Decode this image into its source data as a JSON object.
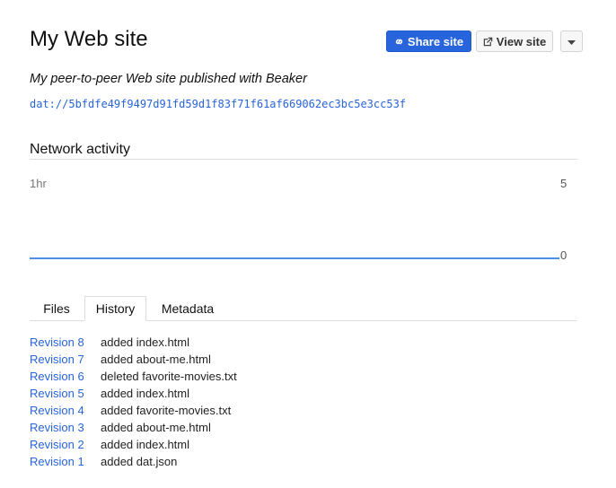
{
  "site": {
    "title": "My Web site",
    "description": "My peer-to-peer Web site published with Beaker",
    "url": "dat://5bfdfe49f9497d91fd59d1f83f71f61af669062ec3bc5e3cc53f"
  },
  "actions": {
    "share_label": "Share site",
    "share_icon": "link-icon",
    "view_label": "View site",
    "view_icon": "external-link-icon",
    "more_icon": "caret-down-icon"
  },
  "network": {
    "heading": "Network activity",
    "time_window": "1hr",
    "max_label": "5",
    "min_label": "0",
    "series_color": "#4a90e2"
  },
  "chart_data": {
    "type": "line",
    "x": [
      0,
      1
    ],
    "values": [
      0,
      0
    ],
    "ylim": [
      0,
      5
    ],
    "grid": false
  },
  "tabs": [
    {
      "label": "Files",
      "active": false
    },
    {
      "label": "History",
      "active": true
    },
    {
      "label": "Metadata",
      "active": false
    }
  ],
  "history": [
    {
      "revision": "Revision 8",
      "message": "added index.html"
    },
    {
      "revision": "Revision 7",
      "message": "added about-me.html"
    },
    {
      "revision": "Revision 6",
      "message": "deleted favorite-movies.txt"
    },
    {
      "revision": "Revision 5",
      "message": "added index.html"
    },
    {
      "revision": "Revision 4",
      "message": "added favorite-movies.txt"
    },
    {
      "revision": "Revision 3",
      "message": "added about-me.html"
    },
    {
      "revision": "Revision 2",
      "message": "added index.html"
    },
    {
      "revision": "Revision 1",
      "message": "added dat.json"
    }
  ],
  "colors": {
    "accent": "#2864dc",
    "link": "#2864dc"
  }
}
